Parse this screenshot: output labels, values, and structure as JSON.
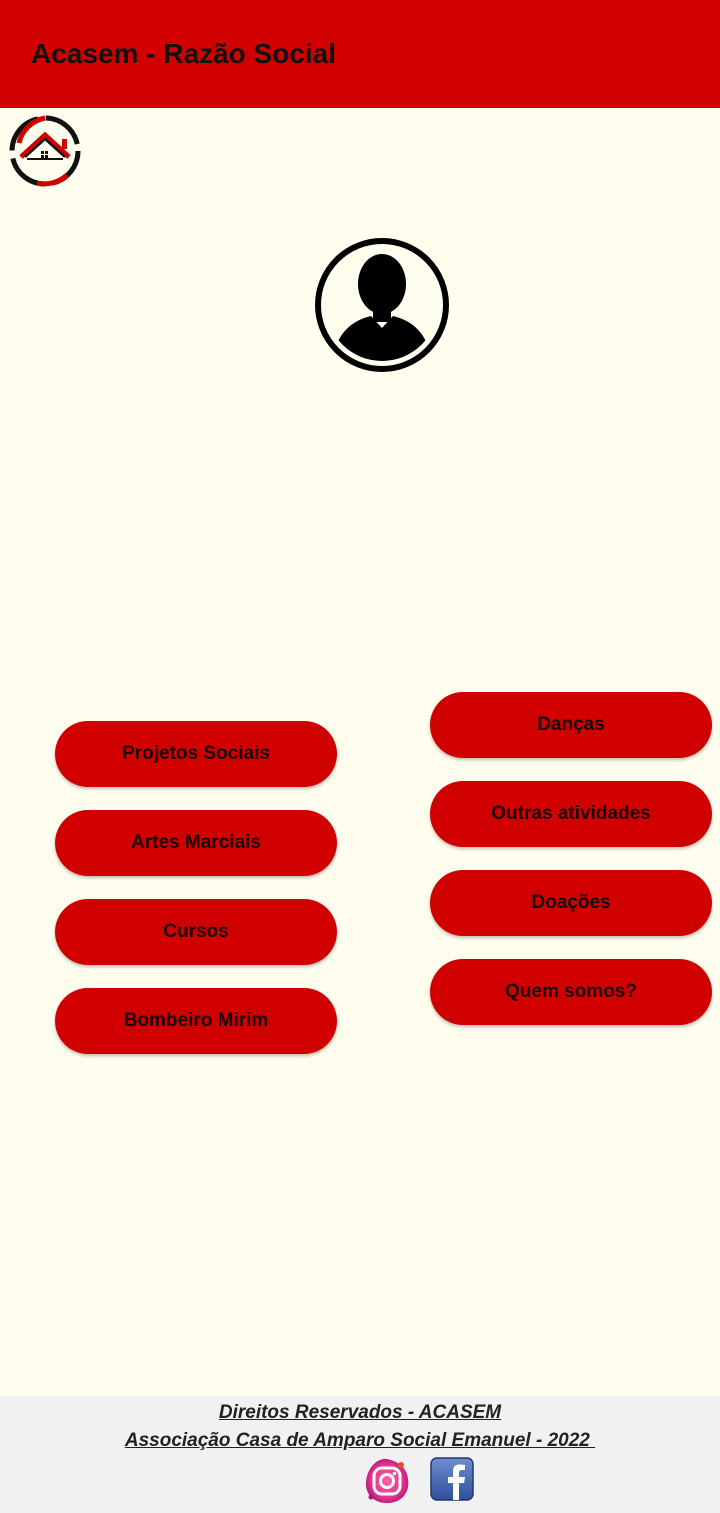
{
  "header": {
    "title": "Acasem - Razão Social"
  },
  "icons": {
    "home": "home-icon",
    "avatar": "user-avatar-icon",
    "instagram": "instagram-icon",
    "facebook": "facebook-icon"
  },
  "menu": {
    "left": [
      {
        "label": "Projetos Sociais"
      },
      {
        "label": "Artes Marciais"
      },
      {
        "label": "Cursos"
      },
      {
        "label": "Bombeiro Mirim"
      }
    ],
    "right": [
      {
        "label": "Danças"
      },
      {
        "label": "Outras atividades"
      },
      {
        "label": "Doações"
      },
      {
        "label": "Quem somos?"
      }
    ]
  },
  "footer": {
    "line1": "Direitos Reservados - ACASEM",
    "line2": "Associação Casa de Amparo Social Emanuel - 2022 "
  },
  "colors": {
    "accent": "#d10000",
    "background": "#fffdee",
    "footer_bg": "#f1f1f1"
  }
}
